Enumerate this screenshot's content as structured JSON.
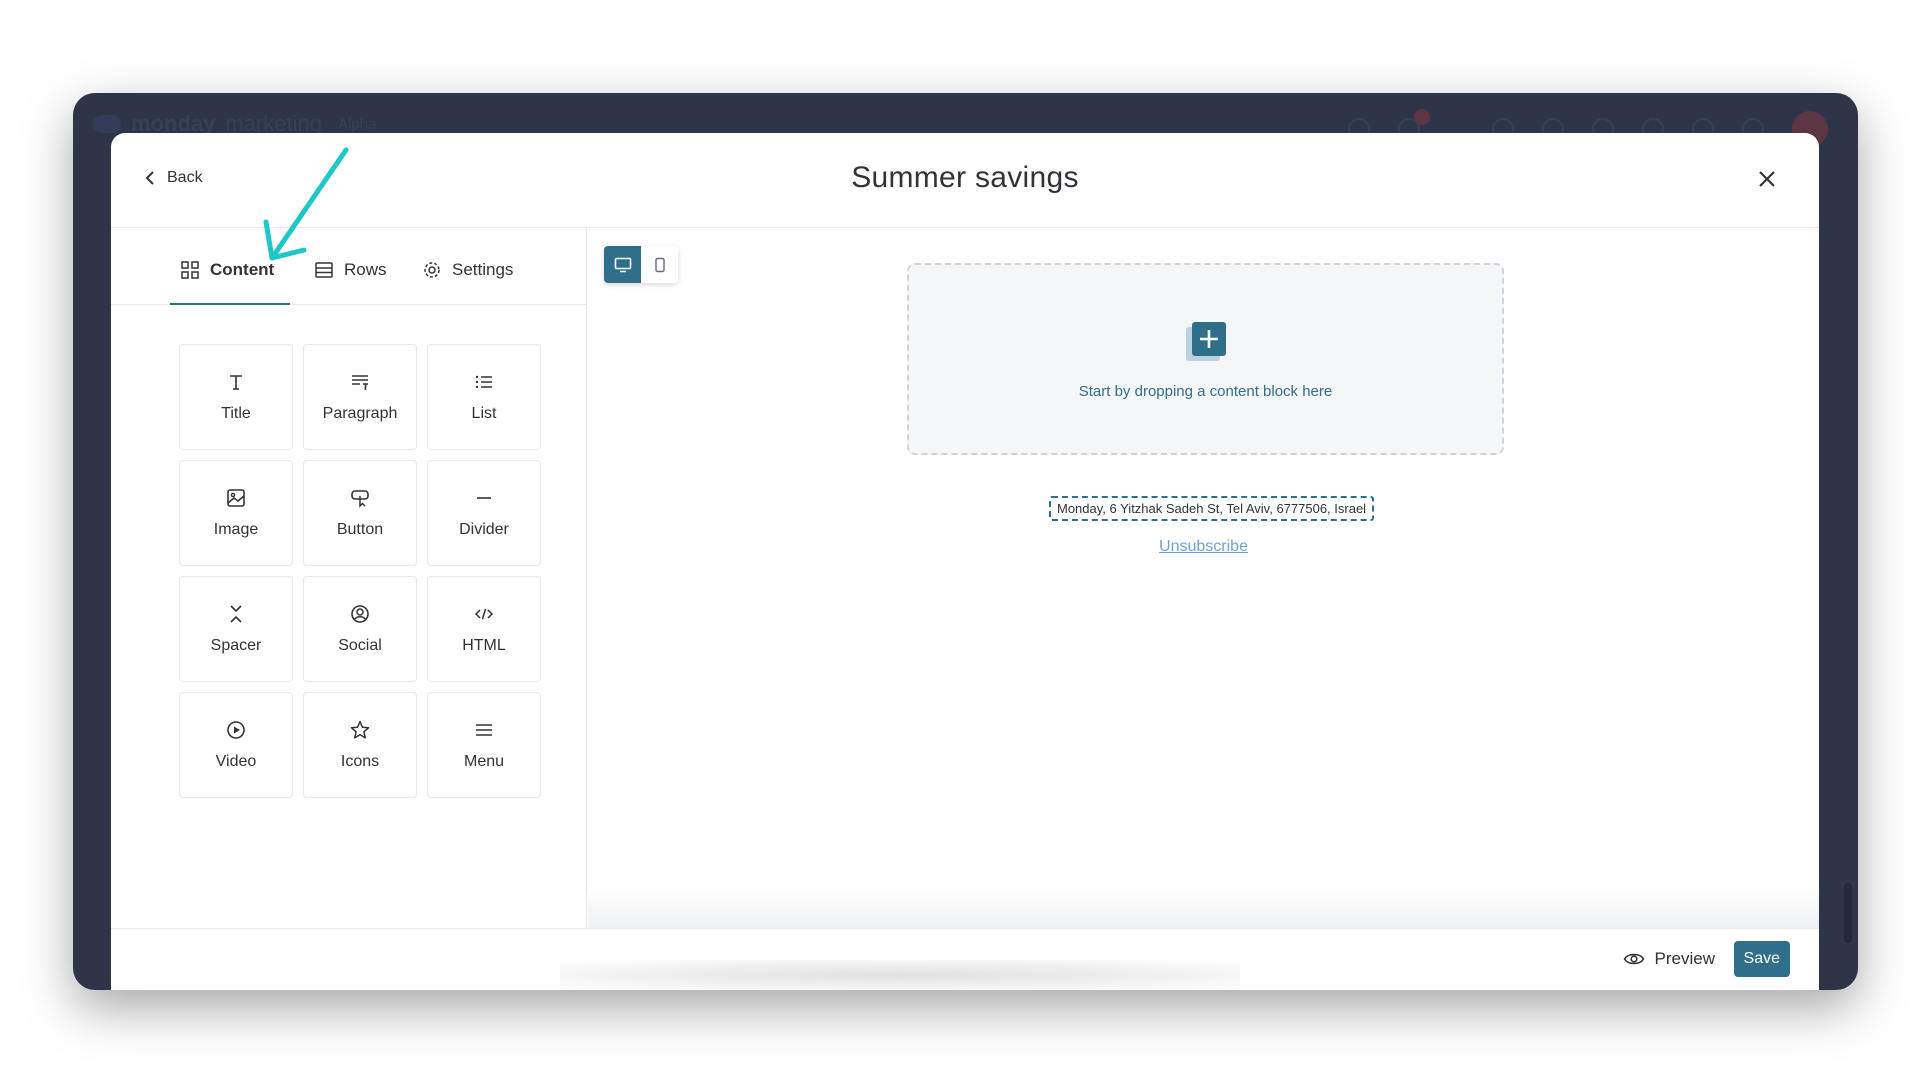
{
  "app": {
    "brand": "monday",
    "brand_suffix": "marketing",
    "tag": "Alpha"
  },
  "modal": {
    "back_label": "Back",
    "title": "Summer savings",
    "close_icon": "close-icon"
  },
  "tabs": [
    {
      "label": "Content",
      "icon": "grid-icon",
      "active": true
    },
    {
      "label": "Rows",
      "icon": "rows-icon",
      "active": false
    },
    {
      "label": "Settings",
      "icon": "gear-icon",
      "active": false
    }
  ],
  "blocks": [
    {
      "label": "Title",
      "icon": "title-icon"
    },
    {
      "label": "Paragraph",
      "icon": "paragraph-icon"
    },
    {
      "label": "List",
      "icon": "list-icon"
    },
    {
      "label": "Image",
      "icon": "image-icon"
    },
    {
      "label": "Button",
      "icon": "button-icon"
    },
    {
      "label": "Divider",
      "icon": "divider-icon"
    },
    {
      "label": "Spacer",
      "icon": "spacer-icon"
    },
    {
      "label": "Social",
      "icon": "social-icon"
    },
    {
      "label": "HTML",
      "icon": "html-icon"
    },
    {
      "label": "Video",
      "icon": "video-icon"
    },
    {
      "label": "Icons",
      "icon": "star-icon"
    },
    {
      "label": "Menu",
      "icon": "menu-icon"
    }
  ],
  "canvas": {
    "device_modes": [
      "desktop",
      "mobile"
    ],
    "active_device": "desktop",
    "drop_text": "Start by dropping a content block here",
    "address": "Monday, 6 Yitzhak Sadeh St, Tel Aviv, 6777506, Israel",
    "unsubscribe_label": "Unsubscribe"
  },
  "footer": {
    "preview_label": "Preview",
    "save_label": "Save"
  },
  "colors": {
    "accent": "#2f6f8c",
    "annotation": "#1ec8c8",
    "link": "#6ea3d8"
  }
}
